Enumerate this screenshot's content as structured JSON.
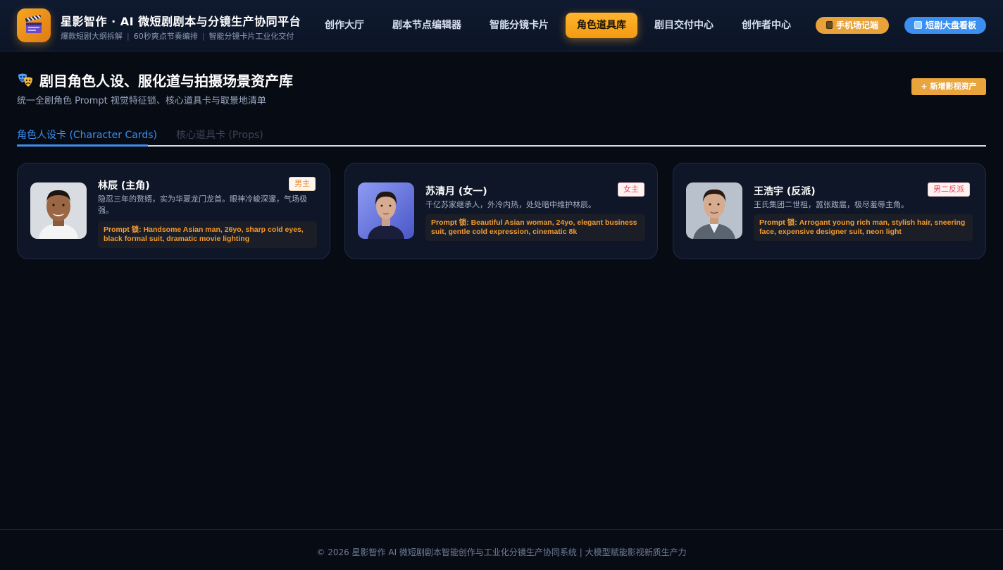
{
  "header": {
    "title": "星影智作 · AI 微短剧剧本与分镜生产协同平台",
    "subtitle": [
      "爆款短剧大纲拆解",
      "60秒爽点节奏编排",
      "智能分镜卡片工业化交付"
    ],
    "nav": [
      {
        "label": "创作大厅",
        "active": false
      },
      {
        "label": "剧本节点编辑器",
        "active": false
      },
      {
        "label": "智能分镜卡片",
        "active": false
      },
      {
        "label": "角色道具库",
        "active": true
      },
      {
        "label": "剧目交付中心",
        "active": false
      },
      {
        "label": "创作者中心",
        "active": false
      }
    ],
    "mobile_label": "手机场记端",
    "board_label": "短剧大盘看板"
  },
  "page": {
    "title": "剧目角色人设、服化道与拍摄场景资产库",
    "desc": "统一全剧角色 Prompt 视觉特征锁、核心道具卡与取景地清单",
    "add_button": "+ 新增影视资产"
  },
  "tabs": [
    {
      "label": "角色人设卡 (Character Cards)",
      "active": true
    },
    {
      "label": "核心道具卡 (Props)",
      "active": false
    }
  ],
  "cards": [
    {
      "name": "林辰 (主角)",
      "badge": "男主",
      "desc": "隐忍三年的赘婿，实为华夏龙门龙首。眼神冷峻深邃，气场极强。",
      "prompt_label": "Prompt 锁:",
      "prompt": "Handsome Asian man, 26yo, sharp cold eyes, black formal suit, dramatic movie lighting"
    },
    {
      "name": "苏清月 (女一)",
      "badge": "女主",
      "desc": "千亿苏家继承人，外冷内热，处处暗中维护林辰。",
      "prompt_label": "Prompt 锁:",
      "prompt": "Beautiful Asian woman, 24yo, elegant business suit, gentle cold expression, cinematic 8k"
    },
    {
      "name": "王浩宇 (反派)",
      "badge": "男二反派",
      "desc": "王氏集团二世祖，嚣张跋扈，极尽羞辱主角。",
      "prompt_label": "Prompt 锁:",
      "prompt": "Arrogant young rich man, stylish hair, sneering face, expensive designer suit, neon light"
    }
  ],
  "footer": {
    "text": "© 2026 星影智作 AI 微短剧剧本智能创作与工业化分镜生产协同系统 | 大模型赋能影视新质生产力"
  },
  "icons": {
    "logo": "clapperboard-icon",
    "mobile": "phone-icon",
    "board": "monitor-icon",
    "title": "theater-masks-icon"
  },
  "colors": {
    "accent": "#f5a623",
    "blue": "#3b8ff0",
    "background": "#070b14",
    "card": "#0f1627"
  }
}
